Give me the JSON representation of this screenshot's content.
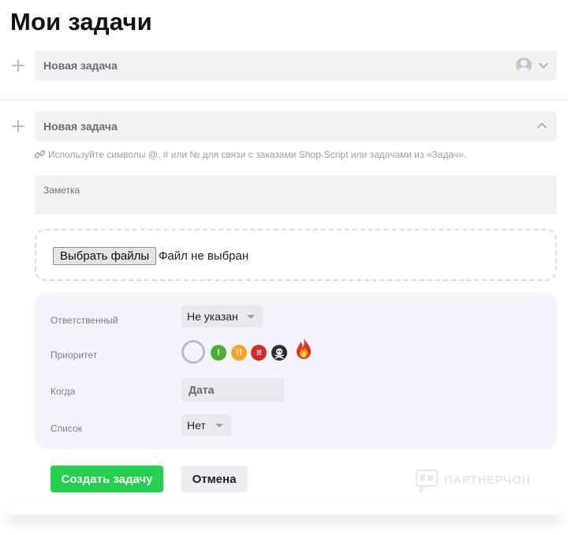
{
  "page": {
    "title": "Мои задачи"
  },
  "task_collapsed": {
    "placeholder": "Новая задача"
  },
  "task_expanded": {
    "placeholder": "Новая задача",
    "hint": "Используйте символы @, # или № для связи с заказами Shop-Script или задачами из «Задач».",
    "note_placeholder": "Заметка"
  },
  "file_upload": {
    "button_label": "Выбрать файлы",
    "status": "Файл не выбран"
  },
  "form": {
    "assignee_label": "Ответственный",
    "assignee_value": "Не указан",
    "priority_label": "Приоритет",
    "priority_levels": [
      "!",
      "!!",
      "!!!"
    ],
    "when_label": "Когда",
    "when_value": "Дата",
    "list_label": "Список",
    "list_value": "Нет"
  },
  "actions": {
    "create_label": "Создать задачу",
    "cancel_label": "Отмена"
  },
  "partner": {
    "logo_text": "ПАРТНЕРЧОН"
  },
  "colors": {
    "create_button": "#24d04d",
    "priority_1": "#4caf32",
    "priority_2": "#f5a623",
    "priority_3": "#d62b2b",
    "panel_background": "#f3f4fc"
  }
}
